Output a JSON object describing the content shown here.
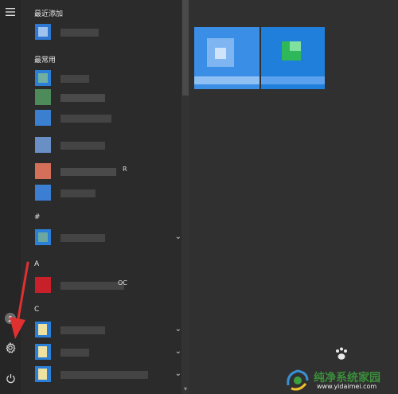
{
  "start_menu": {
    "sections": {
      "recent": "最近添加",
      "most_used": "最常用",
      "hash": "#",
      "a": "A",
      "c": "C"
    },
    "partial_labels": {
      "row5_suffix": "R",
      "row8_suffix": "OC"
    }
  },
  "icons": {
    "menu": "hamburger-icon",
    "user": "user-icon",
    "settings": "gear-icon",
    "power": "power-icon",
    "expand": "chevron-down-icon",
    "annotation": "red-arrow"
  },
  "watermark": {
    "main": "纯净系统家园",
    "url": "www.yidaimei.com"
  },
  "colors": {
    "background": "#2b2b2b",
    "tile_blue": "#3a8ee6",
    "arrow_red": "#e03030",
    "watermark_green": "#3a8f3a"
  }
}
